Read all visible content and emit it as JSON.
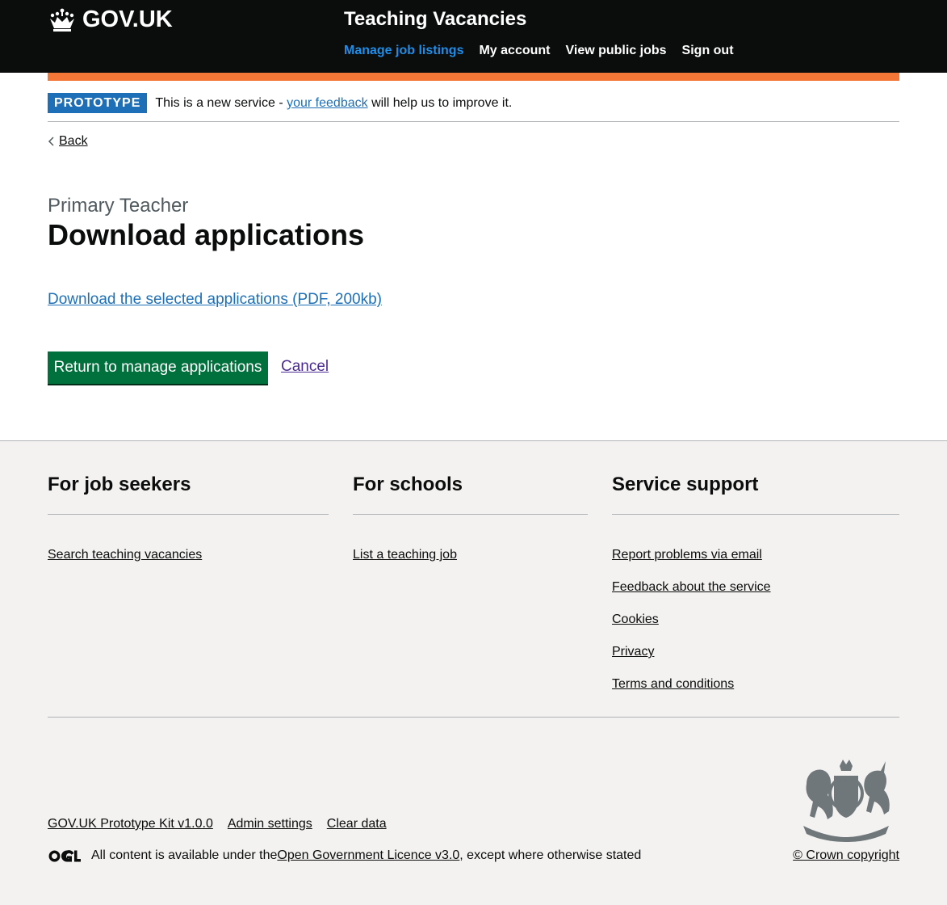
{
  "header": {
    "logo_text": "GOV.UK",
    "service_name": "Teaching Vacancies",
    "nav": [
      {
        "label": "Manage job listings",
        "active": true
      },
      {
        "label": "My account",
        "active": false
      },
      {
        "label": "View public jobs",
        "active": false
      },
      {
        "label": "Sign out",
        "active": false
      }
    ]
  },
  "phase_banner": {
    "tag": "PROTOTYPE",
    "text_before": "This is a new service - ",
    "link": "your feedback",
    "text_after": " will help us to improve it."
  },
  "back_link": "Back",
  "page": {
    "caption": "Primary Teacher",
    "title": "Download applications",
    "download_link": "Download the selected applications (PDF, 200kb)",
    "primary_button": "Return to manage applications",
    "cancel_link": "Cancel"
  },
  "footer": {
    "columns": [
      {
        "heading": "For job seekers",
        "links": [
          "Search teaching vacancies"
        ]
      },
      {
        "heading": "For schools",
        "links": [
          "List a teaching job"
        ]
      },
      {
        "heading": "Service support",
        "links": [
          "Report problems via email",
          "Feedback about the service",
          "Cookies",
          "Privacy",
          "Terms and conditions"
        ]
      }
    ],
    "meta_links": [
      "GOV.UK Prototype Kit v1.0.0",
      "Admin settings",
      "Clear data"
    ],
    "licence_before": "All content is available under the ",
    "licence_link": "Open Government Licence v3.0",
    "licence_after": ", except where otherwise stated",
    "copyright": "© Crown copyright"
  },
  "colors": {
    "header_bg": "#0b0c0c",
    "phase_orange": "#f47738",
    "link_blue": "#1d70b8",
    "button_green": "#00703c",
    "visited_purple": "#4c2c92",
    "footer_bg": "#f3f2f1"
  }
}
